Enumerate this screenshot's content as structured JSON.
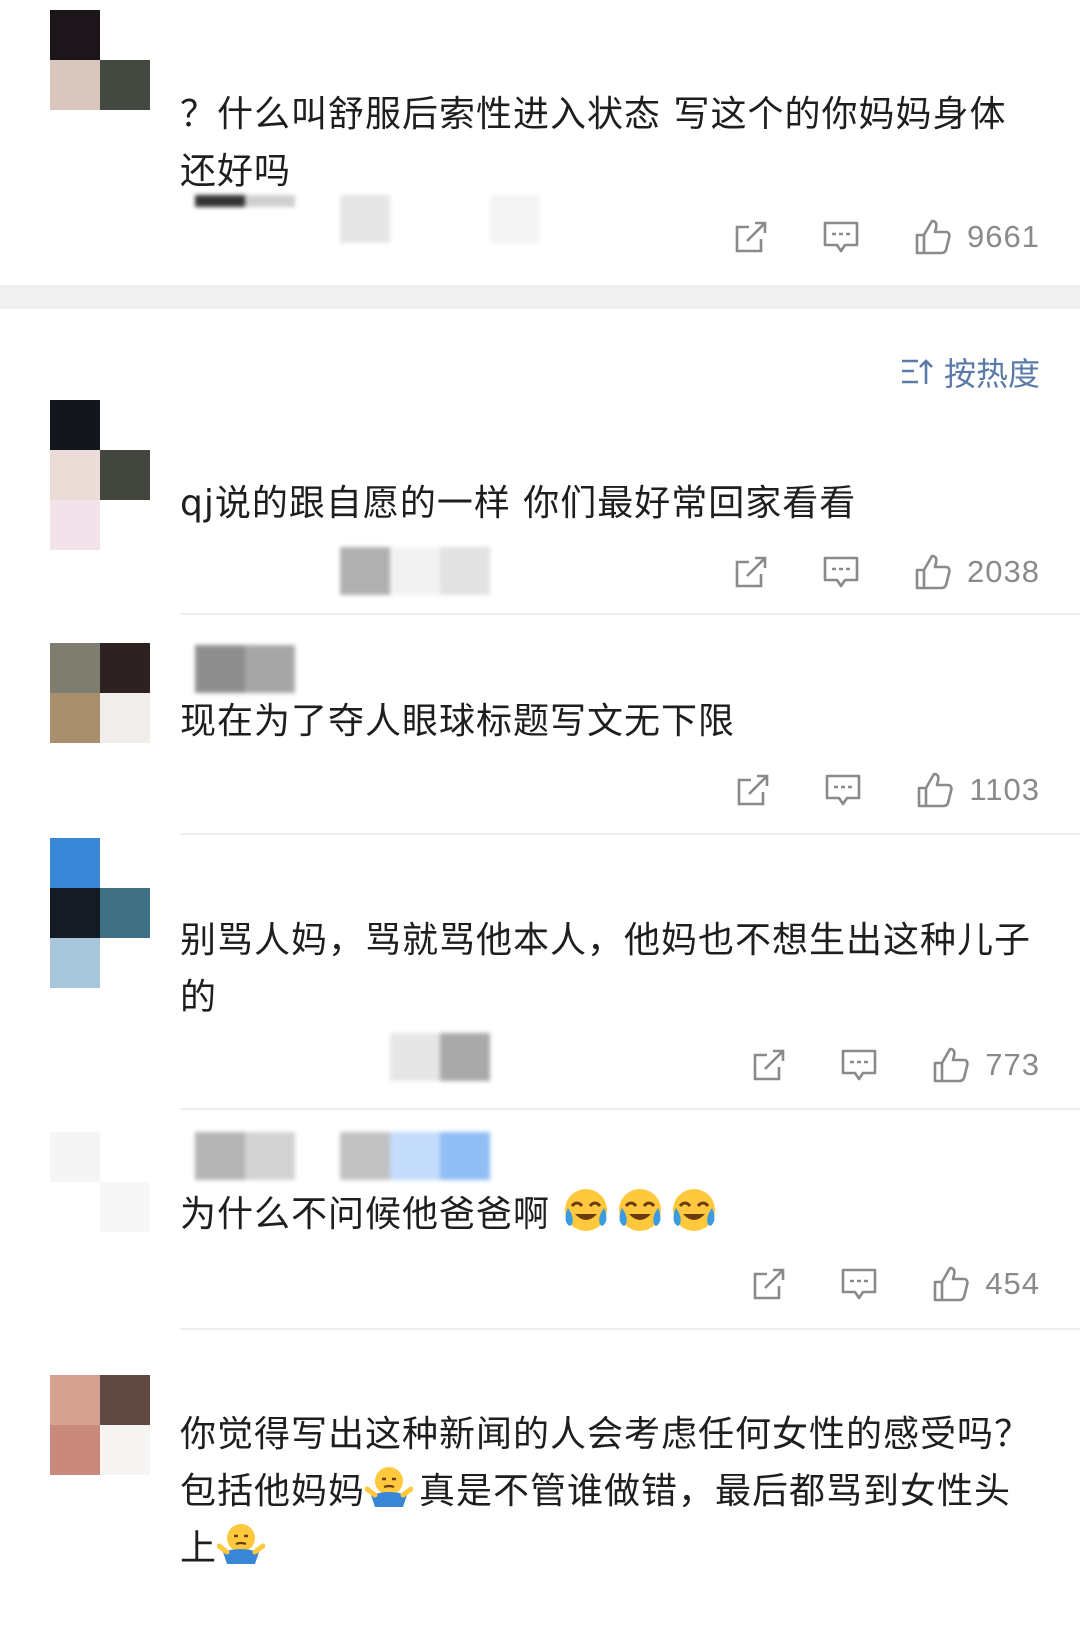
{
  "sort_label": "按热度",
  "comments": [
    {
      "text": "？什么叫舒服后索性进入状态 写这个的你妈妈身体还好吗",
      "likes": "9661"
    },
    {
      "text": "qj说的跟自愿的一样 你们最好常回家看看",
      "likes": "2038"
    },
    {
      "text": "现在为了夺人眼球标题写文无下限",
      "likes": "1103"
    },
    {
      "text": "别骂人妈，骂就骂他本人，他妈也不想生出这种儿子的",
      "likes": "773"
    },
    {
      "text": "为什么不问候他爸爸啊",
      "likes": "454",
      "emojis": [
        "crying-laugh-emoji",
        "crying-laugh-emoji",
        "crying-laugh-emoji"
      ]
    },
    {
      "text_part1": "你觉得写出这种新闻的人会考虑任何女性的感受吗？包括他妈妈",
      "text_part2": "真是不管谁做错，最后都骂到女性头上"
    }
  ],
  "colors": {
    "accent": "#5a7aa8",
    "like": "#8a8a8a",
    "divider": "#eeeeee"
  }
}
